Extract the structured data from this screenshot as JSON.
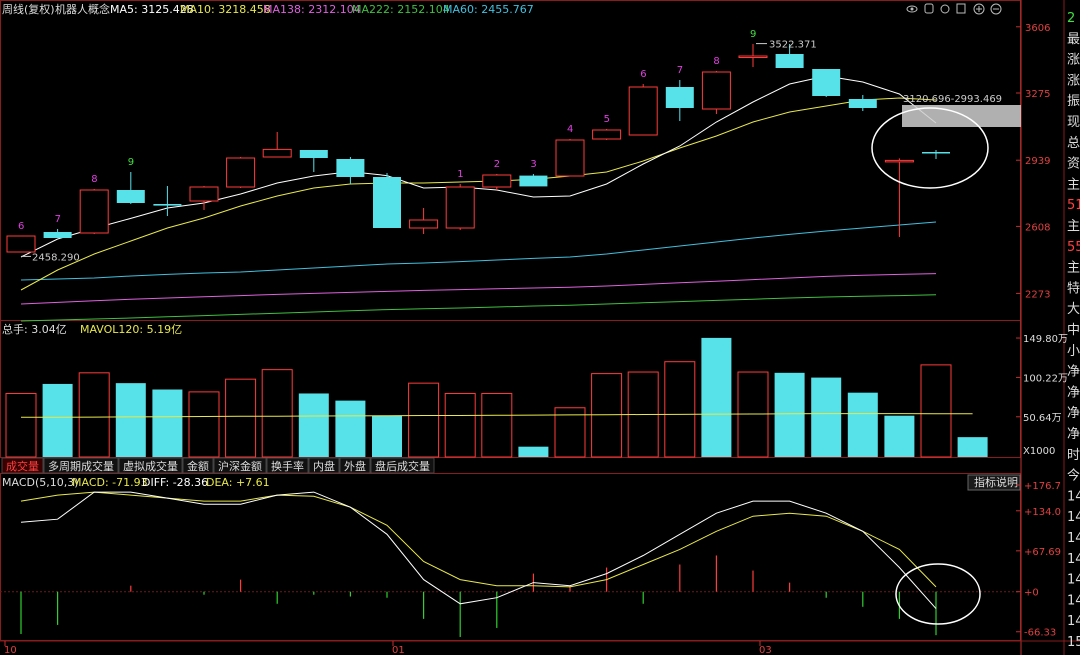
{
  "header": {
    "title": "周线(复权)",
    "stock": "机器人概念",
    "ma": [
      {
        "label": "MA5: 3125.428",
        "color": "#ffffff"
      },
      {
        "label": "MA10: 3218.458",
        "color": "#e8e84a"
      },
      {
        "label": "MA138: 2312.104",
        "color": "#e060e0"
      },
      {
        "label": "MA222: 2152.104",
        "color": "#40c040"
      },
      {
        "label": "MA60: 2455.767",
        "color": "#40c0e0"
      }
    ],
    "icons": [
      "eye-icon",
      "hand-icon",
      "refresh-icon",
      "list-icon",
      "plus-icon",
      "minus-icon"
    ]
  },
  "volume_header": {
    "total": "总手: 3.04亿",
    "mavol": "MAVOL120: 5.19亿"
  },
  "macd_header": {
    "name": "MACD(5,10,3)",
    "macd": "MACD: -71.93",
    "diff": "DIFF: -28.36",
    "dea": "DEA: +7.61"
  },
  "tabs": [
    "成交量",
    "多周期成交量",
    "虚拟成交量",
    "金额",
    "沪深金额",
    "换手率",
    "内盘",
    "外盘",
    "盘后成交量"
  ],
  "help_button": "指标说明",
  "right_panel": [
    "2",
    "最",
    "涨",
    "涨",
    "振",
    "现",
    "总",
    "资",
    "主",
    "51",
    "主",
    "55",
    "主",
    "特",
    "大",
    "中",
    "小",
    "净",
    "净",
    "净",
    "净",
    "时",
    "今",
    "14",
    "14",
    "14",
    "14",
    "14",
    "14",
    "14",
    "15"
  ],
  "chart_data": [
    {
      "type": "candlestick",
      "name": "price",
      "ylim": [
        2150,
        3650
      ],
      "yticks": [
        "3606",
        "3275",
        "2939",
        "2608",
        "2273"
      ],
      "candles": [
        {
          "o": 2560,
          "h": 2560,
          "l": 2480,
          "c": 2480,
          "up": true
        },
        {
          "o": 2580,
          "h": 2595,
          "l": 2552,
          "c": 2550,
          "up": false
        },
        {
          "o": 2575,
          "h": 2795,
          "l": 2570,
          "c": 2790,
          "up": true
        },
        {
          "o": 2790,
          "h": 2880,
          "l": 2720,
          "c": 2725,
          "up": false
        },
        {
          "o": 2720,
          "h": 2810,
          "l": 2660,
          "c": 2712,
          "up": false
        },
        {
          "o": 2735,
          "h": 2810,
          "l": 2690,
          "c": 2805,
          "up": true
        },
        {
          "o": 2805,
          "h": 2955,
          "l": 2800,
          "c": 2950,
          "up": true
        },
        {
          "o": 2955,
          "h": 3080,
          "l": 2955,
          "c": 2993,
          "up": true
        },
        {
          "o": 2990,
          "h": 2990,
          "l": 2880,
          "c": 2950,
          "up": false
        },
        {
          "o": 2945,
          "h": 2955,
          "l": 2820,
          "c": 2855,
          "up": false
        },
        {
          "o": 2855,
          "h": 2875,
          "l": 2600,
          "c": 2600,
          "up": false
        },
        {
          "o": 2600,
          "h": 2700,
          "l": 2570,
          "c": 2640,
          "up": true
        },
        {
          "o": 2600,
          "h": 2820,
          "l": 2590,
          "c": 2805,
          "up": true
        },
        {
          "o": 2805,
          "h": 2870,
          "l": 2790,
          "c": 2865,
          "up": true
        },
        {
          "o": 2862,
          "h": 2870,
          "l": 2815,
          "c": 2808,
          "up": false
        },
        {
          "o": 2860,
          "h": 3045,
          "l": 2860,
          "c": 3040,
          "up": true
        },
        {
          "o": 3045,
          "h": 3095,
          "l": 3040,
          "c": 3090,
          "up": true
        },
        {
          "o": 3065,
          "h": 3320,
          "l": 3065,
          "c": 3305,
          "up": true
        },
        {
          "o": 3305,
          "h": 3340,
          "l": 3135,
          "c": 3200,
          "up": false
        },
        {
          "o": 3195,
          "h": 3385,
          "l": 3170,
          "c": 3380,
          "up": true
        },
        {
          "o": 3460,
          "h": 3520,
          "l": 3405,
          "c": 3460,
          "up": true
        },
        {
          "o": 3470,
          "h": 3520,
          "l": 3405,
          "c": 3400,
          "up": false
        },
        {
          "o": 3395,
          "h": 3395,
          "l": 3255,
          "c": 3260,
          "up": false
        },
        {
          "o": 3245,
          "h": 3265,
          "l": 3185,
          "c": 3200,
          "up": false
        },
        {
          "o": 2938,
          "h": 2948,
          "l": 2555,
          "c": 2938,
          "up": true
        },
        {
          "o": 2980,
          "h": 2990,
          "l": 2945,
          "c": 2975,
          "up": false
        }
      ],
      "count_labels": [
        "6",
        "7",
        "8",
        "9",
        "",
        "",
        "",
        "",
        "",
        "",
        "",
        "",
        "1",
        "2",
        "3",
        "4",
        "5",
        "6",
        "7",
        "8",
        "9",
        "",
        "",
        "",
        "",
        ""
      ],
      "annotations": {
        "high": "3522.371",
        "low": "2458.290",
        "range": "3120.696-2993.469"
      },
      "ma5": [
        2455,
        2545,
        2598,
        2648,
        2700,
        2725,
        2770,
        2825,
        2860,
        2882,
        2862,
        2800,
        2805,
        2790,
        2755,
        2760,
        2820,
        2920,
        3010,
        3130,
        3230,
        3320,
        3360,
        3330,
        3270,
        3125
      ],
      "ma10": [
        2290,
        2390,
        2470,
        2535,
        2600,
        2650,
        2710,
        2760,
        2800,
        2820,
        2825,
        2825,
        2830,
        2835,
        2843,
        2860,
        2880,
        2935,
        3000,
        3060,
        3130,
        3180,
        3210,
        3240,
        3250,
        3240
      ],
      "ma60": [
        2340,
        2345,
        2350,
        2360,
        2368,
        2375,
        2380,
        2390,
        2400,
        2410,
        2420,
        2425,
        2432,
        2440,
        2448,
        2455,
        2470,
        2490,
        2510,
        2530,
        2550,
        2568,
        2585,
        2600,
        2615,
        2630
      ],
      "ma138": [
        2220,
        2228,
        2236,
        2244,
        2250,
        2256,
        2262,
        2268,
        2273,
        2278,
        2283,
        2288,
        2292,
        2296,
        2300,
        2304,
        2310,
        2318,
        2326,
        2334,
        2342,
        2350,
        2358,
        2364,
        2368,
        2372
      ],
      "ma222": [
        2135,
        2140,
        2145,
        2150,
        2156,
        2162,
        2168,
        2174,
        2180,
        2186,
        2192,
        2196,
        2200,
        2205,
        2210,
        2214,
        2220,
        2226,
        2232,
        2238,
        2244,
        2250,
        2255,
        2259,
        2262,
        2266
      ]
    },
    {
      "type": "bar",
      "name": "volume",
      "ylim": [
        0,
        170
      ],
      "yticks": [
        "149.80万",
        "100.22万",
        "50.64万"
      ],
      "unit": "X1000",
      "values": [
        80,
        92,
        106,
        93,
        85,
        82,
        98,
        110,
        80,
        71,
        52,
        93,
        80,
        80,
        13,
        62,
        105,
        107,
        120,
        150,
        107,
        106,
        100,
        81,
        52,
        116,
        25
      ],
      "up": [
        true,
        false,
        true,
        false,
        false,
        true,
        true,
        true,
        false,
        false,
        false,
        true,
        true,
        true,
        false,
        true,
        true,
        true,
        true,
        false,
        true,
        false,
        false,
        false,
        false,
        true,
        false
      ],
      "mavol": [
        50,
        50,
        50.3,
        50.5,
        50.7,
        51,
        51.2,
        51.4,
        51.6,
        51.8,
        52,
        52.2,
        52.3,
        52.5,
        52.7,
        53,
        53.2,
        53.5,
        53.7,
        54,
        54.2,
        54.4,
        54.6,
        54.6,
        54.6,
        54.5,
        54.4
      ]
    },
    {
      "type": "line",
      "name": "macd",
      "ylim": [
        -80,
        185
      ],
      "yticks": [
        "+176.7",
        "+134.0",
        "+67.69",
        "+0",
        "-66.33"
      ],
      "diff": [
        115,
        120,
        165,
        165,
        155,
        145,
        145,
        160,
        165,
        140,
        95,
        20,
        -20,
        -10,
        15,
        10,
        30,
        60,
        95,
        130,
        150,
        150,
        130,
        100,
        40,
        -28
      ],
      "dea": [
        150,
        160,
        165,
        160,
        155,
        150,
        150,
        160,
        158,
        140,
        110,
        50,
        20,
        10,
        10,
        8,
        20,
        45,
        70,
        100,
        125,
        130,
        125,
        100,
        70,
        8
      ],
      "hist": [
        -70,
        -55,
        0,
        10,
        0,
        -5,
        20,
        -20,
        -5,
        -8,
        -10,
        -45,
        -75,
        -60,
        30,
        10,
        40,
        -20,
        45,
        60,
        35,
        15,
        -10,
        -25,
        -45,
        -72
      ]
    }
  ],
  "x_axis": {
    "labels": [
      "10",
      "01",
      "03"
    ]
  },
  "colors": {
    "up": "#ff3b3b",
    "down": "#56e2e8",
    "grid": "#8a1c1c",
    "axis": "#c03030"
  }
}
